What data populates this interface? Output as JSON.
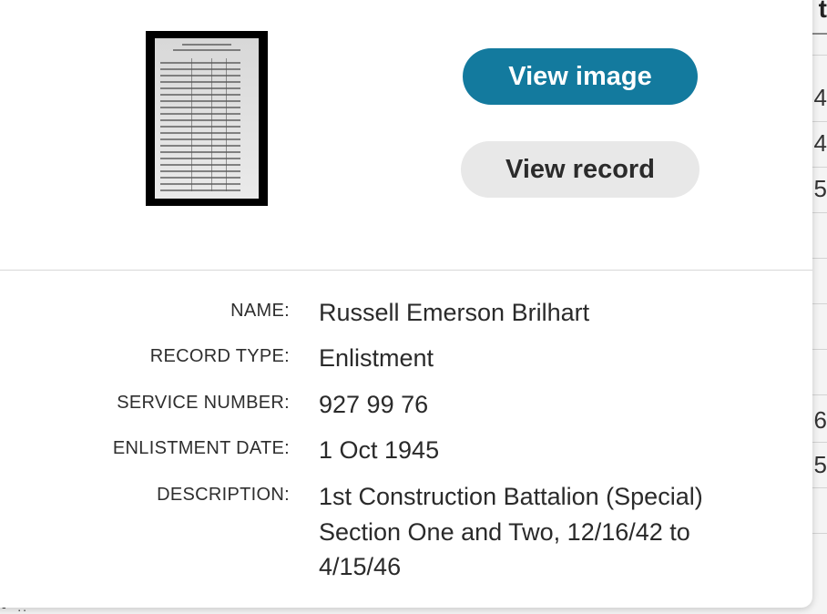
{
  "background": {
    "header_fragment": "t",
    "cells": [
      "4",
      "4",
      "5",
      "6",
      "5"
    ],
    "dots": "-' .."
  },
  "popup": {
    "buttons": {
      "view_image": "View image",
      "view_record": "View record"
    },
    "fields": [
      {
        "label": "NAME:",
        "value": "Russell Emerson Brilhart"
      },
      {
        "label": "RECORD TYPE:",
        "value": "Enlistment"
      },
      {
        "label": "SERVICE NUMBER:",
        "value": "927 99 76"
      },
      {
        "label": "ENLISTMENT DATE:",
        "value": "1 Oct 1945"
      },
      {
        "label": "DESCRIPTION:",
        "value": "1st Construction Battalion (Special) Section One and Two, 12/16/42 to 4/15/46"
      }
    ]
  },
  "colors": {
    "primary_button": "#137a9e",
    "secondary_button": "#e8e8e8"
  }
}
